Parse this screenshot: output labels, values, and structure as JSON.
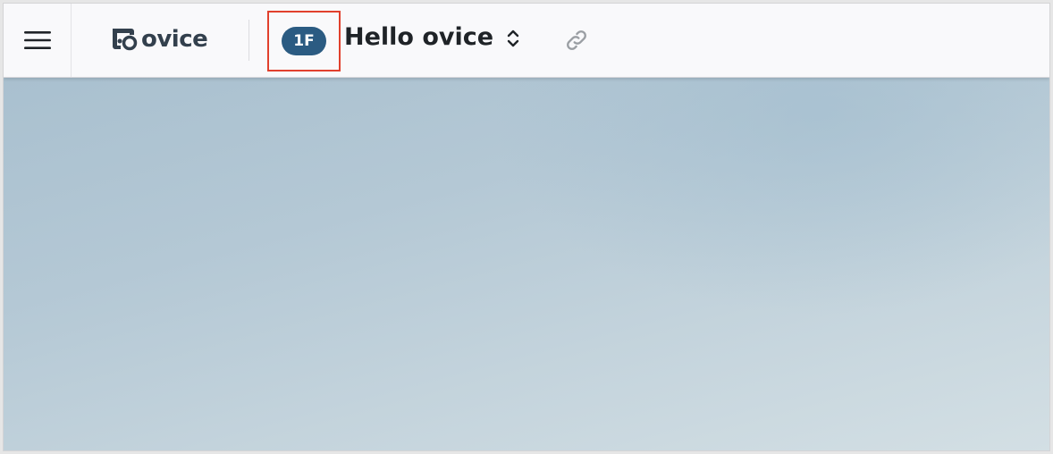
{
  "app": {
    "brand": "ovice"
  },
  "topbar": {
    "floor_badge": "1F",
    "space_title": "Hello ovice",
    "icons": {
      "menu": "hamburger-menu-icon",
      "logo": "ovice-logo-icon",
      "switch": "chevron-up-down-icon",
      "link": "link-icon"
    }
  },
  "colors": {
    "badge": "#2b5b82",
    "highlight": "#e1402d",
    "brand_text": "#33404d"
  }
}
